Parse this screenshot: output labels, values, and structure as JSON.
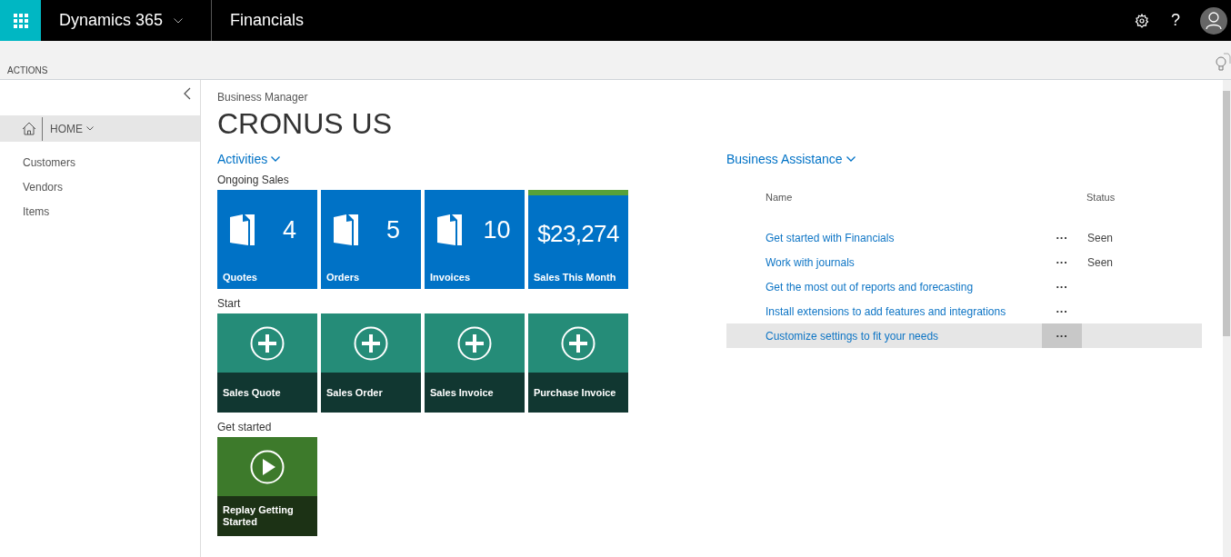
{
  "header": {
    "product": "Dynamics 365",
    "app": "Financials",
    "help": "?"
  },
  "actions_bar": {
    "label": "ACTIONS"
  },
  "sidebar": {
    "home": "HOME",
    "items": [
      {
        "label": "Customers"
      },
      {
        "label": "Vendors"
      },
      {
        "label": "Items"
      }
    ]
  },
  "page": {
    "role": "Business Manager",
    "company": "CRONUS US"
  },
  "activities": {
    "title": "Activities",
    "groups": [
      {
        "title": "Ongoing Sales",
        "tiles": [
          {
            "kind": "cue",
            "value": "4",
            "label": "Quotes"
          },
          {
            "kind": "cue",
            "value": "5",
            "label": "Orders"
          },
          {
            "kind": "cue",
            "value": "10",
            "label": "Invoices"
          },
          {
            "kind": "amount",
            "value": "$23,274",
            "label": "Sales This Month"
          }
        ]
      },
      {
        "title": "Start",
        "tiles": [
          {
            "kind": "action",
            "label": "Sales Quote"
          },
          {
            "kind": "action",
            "label": "Sales Order"
          },
          {
            "kind": "action",
            "label": "Sales Invoice"
          },
          {
            "kind": "action",
            "label": "Purchase Invoice"
          }
        ]
      },
      {
        "title": "Get started",
        "tiles": [
          {
            "kind": "play",
            "label": "Replay Getting Started"
          }
        ]
      }
    ]
  },
  "business_assistance": {
    "title": "Business Assistance",
    "columns": [
      "Name",
      "Status"
    ],
    "rows": [
      {
        "name": "Get started with Financials",
        "menu": "···",
        "status": "Seen",
        "selected": false
      },
      {
        "name": "Work with journals",
        "menu": "···",
        "status": "Seen",
        "selected": false
      },
      {
        "name": "Get the most out of reports and forecasting",
        "menu": "···",
        "selected": false
      },
      {
        "name": "Install extensions to add features and integrations",
        "menu": "···",
        "selected": false
      },
      {
        "name": "Customize settings to fit your needs",
        "menu": "···",
        "selected": true
      }
    ]
  }
}
